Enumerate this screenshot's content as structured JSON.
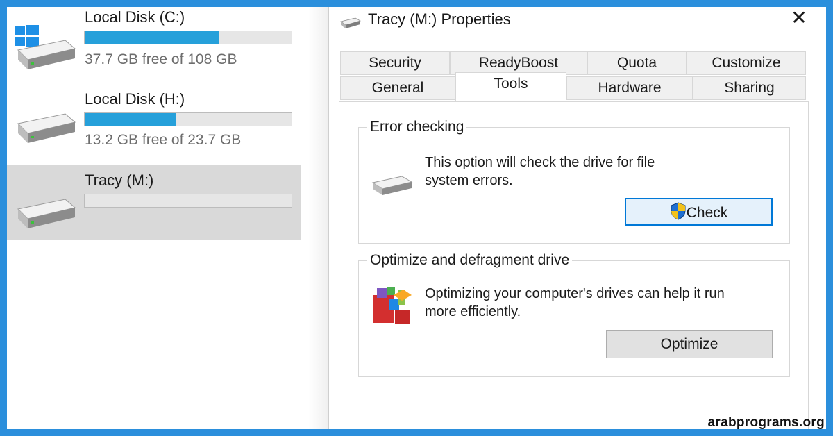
{
  "explorer": {
    "drives": [
      {
        "name": "Local Disk (C:)",
        "free_text": "37.7 GB free of 108 GB",
        "used_fraction": 0.65,
        "icon": "windows-drive-icon"
      },
      {
        "name": "Local Disk (H:)",
        "free_text": "13.2 GB free of 23.7 GB",
        "used_fraction": 0.44,
        "icon": "hard-drive-icon"
      },
      {
        "name": "Tracy (M:)",
        "free_text": "",
        "used_fraction": 0.0,
        "icon": "hard-drive-icon",
        "selected": true
      }
    ]
  },
  "dialog": {
    "title": "Tracy (M:) Properties",
    "close_glyph": "✕",
    "tabs_row1": [
      "Security",
      "ReadyBoost",
      "Quota",
      "Customize"
    ],
    "tabs_row2": [
      "General",
      "Tools",
      "Hardware",
      "Sharing"
    ],
    "active_tab": "Tools",
    "error_checking": {
      "label": "Error checking",
      "description_line1": "This option will check the drive for file",
      "description_line2": "system errors.",
      "button_label": "Check"
    },
    "optimize": {
      "label": "Optimize and defragment drive",
      "description_line1": "Optimizing your computer's drives can help it run",
      "description_line2": "more efficiently.",
      "button_label": "Optimize"
    }
  },
  "watermark": "arabprograms.org",
  "colors": {
    "frame": "#2b8fdc",
    "bar_fill": "#26a0da",
    "selection": "#d9d9d9",
    "focus_border": "#0078d7"
  }
}
